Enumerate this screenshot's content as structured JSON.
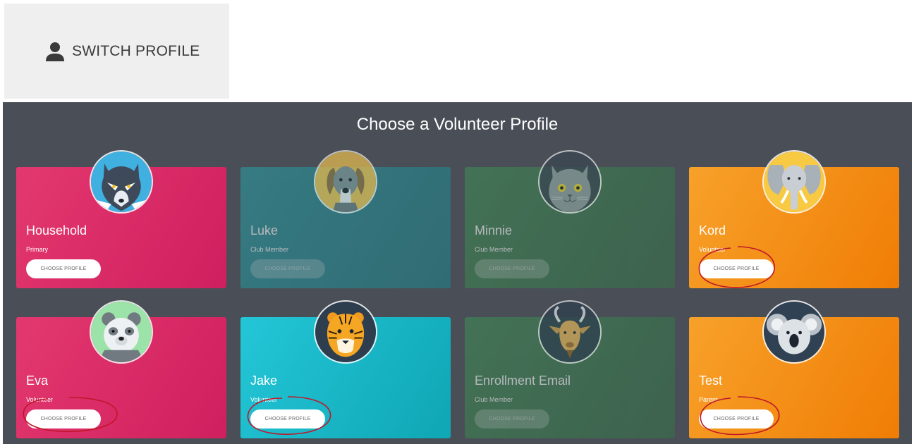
{
  "switch_profile": {
    "label": "SWITCH PROFILE",
    "icon": "person-icon"
  },
  "panel": {
    "title": "Choose a Volunteer Profile"
  },
  "profiles": [
    {
      "name": "Household",
      "role": "Primary",
      "button": "CHOOSE PROFILE",
      "avatar": "wolf-icon",
      "enabled": true
    },
    {
      "name": "Luke",
      "role": "Club Member",
      "button": "CHOOSE PROFILE",
      "avatar": "dog-icon",
      "enabled": false
    },
    {
      "name": "Minnie",
      "role": "Club Member",
      "button": "CHOOSE PROFILE",
      "avatar": "cat-icon",
      "enabled": false
    },
    {
      "name": "Kord",
      "role": "Volunteer",
      "button": "CHOOSE PROFILE",
      "avatar": "elephant-icon",
      "enabled": true
    },
    {
      "name": "Eva",
      "role": "Volunteer",
      "button": "CHOOSE PROFILE",
      "avatar": "bear-icon",
      "enabled": true
    },
    {
      "name": "Jake",
      "role": "Volunteer",
      "button": "CHOOSE PROFILE",
      "avatar": "tiger-icon",
      "enabled": true
    },
    {
      "name": "Enrollment Email",
      "role": "Club Member",
      "button": "CHOOSE PROFILE",
      "avatar": "goat-icon",
      "enabled": false
    },
    {
      "name": "Test",
      "role": "Parent",
      "button": "CHOOSE PROFILE",
      "avatar": "koala-icon",
      "enabled": true
    }
  ],
  "colors": {
    "pink": "#e0306c",
    "teal": "#2a8a92",
    "green": "#3f7b52",
    "orange": "#f5900f",
    "cyan": "#1cc2d3",
    "panel_bg": "#4a4f57",
    "annotation": "#c0172a"
  }
}
